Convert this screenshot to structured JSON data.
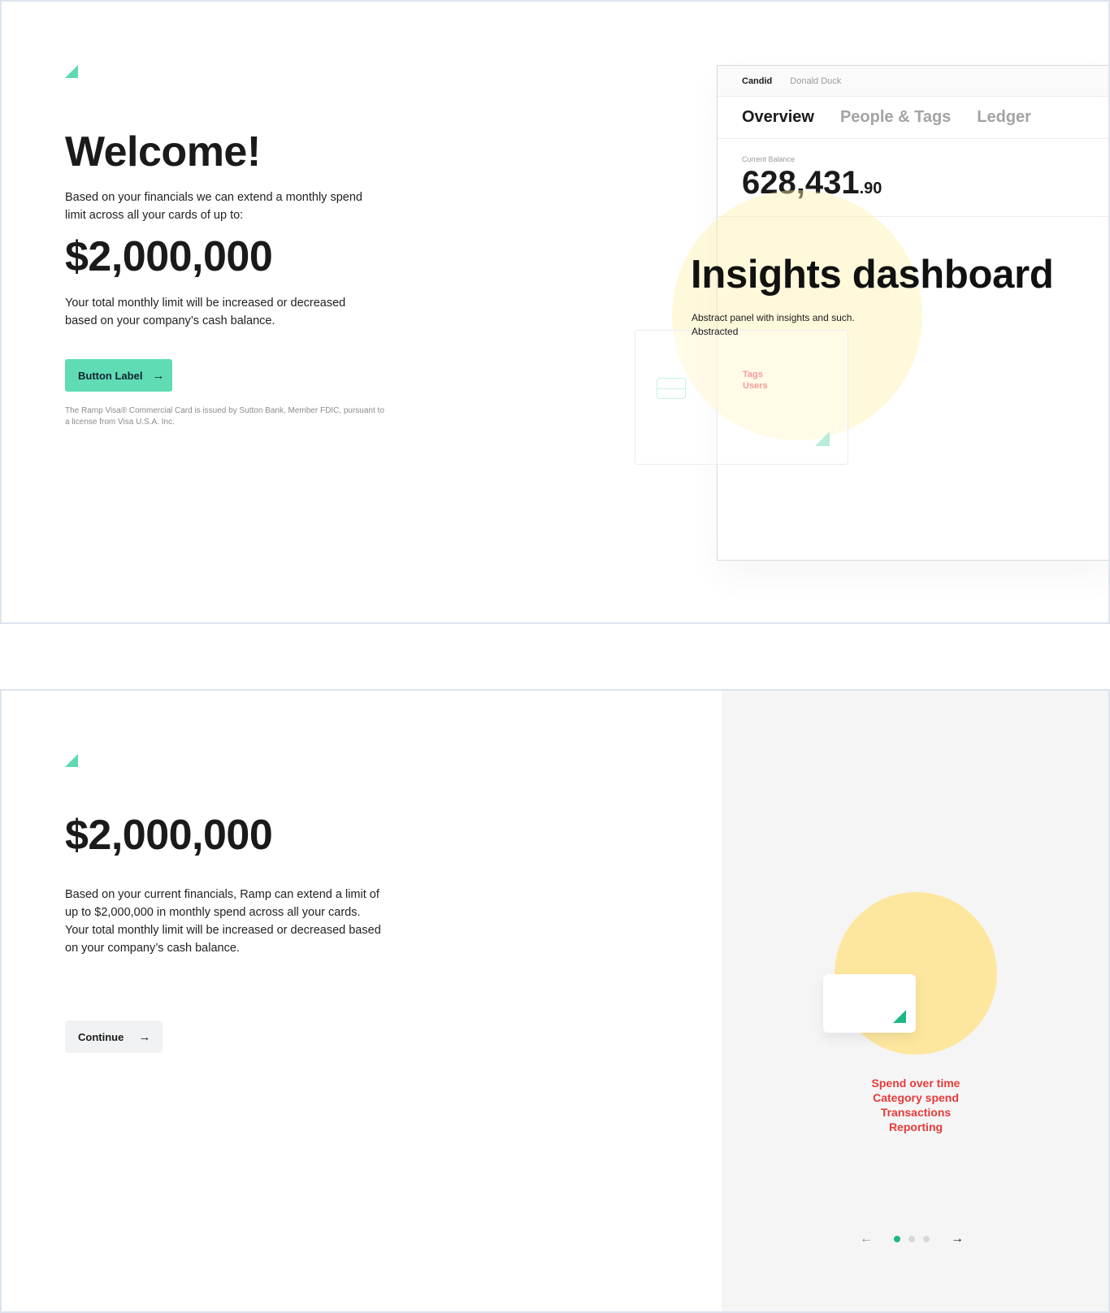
{
  "frame1": {
    "heading": "Welcome!",
    "intro": "Based on your financials we can extend a monthly spend limit across all your cards of up to:",
    "amount": "$2,000,000",
    "note": "Your total monthly limit will be increased or decreased based on your company’s cash balance.",
    "button_label": "Button Label",
    "fineprint": "The Ramp Visa® Commercial Card is issued by Sutton Bank, Member FDIC, pursuant to a license from Visa U.S.A. Inc.",
    "dashboard": {
      "org": "Candid",
      "user": "Donald Duck",
      "tabs": [
        "Overview",
        "People & Tags",
        "Ledger"
      ],
      "balance_label": "Current Balance",
      "balance_whole": "628,431",
      "balance_cents": ".90"
    },
    "mini_card_links": [
      "Tags",
      "Users"
    ],
    "insights_title": "Insights dashboard",
    "insights_desc": "Abstract panel with insights and such. Abstracted"
  },
  "frame2": {
    "amount": "$2,000,000",
    "description": "Based on your current financials, Ramp can extend a limit of up to $2,000,000 in monthly spend across all your cards. Your total monthly limit will be increased or decreased based on your company’s cash balance.",
    "continue_label": "Continue",
    "features": [
      "Spend over time",
      "Category spend",
      "Transactions",
      "Reporting"
    ],
    "carousel": {
      "total": 3,
      "active": 1
    }
  },
  "colors": {
    "brand_green": "#5fdcb3",
    "accent_green": "#1db784",
    "feature_red": "#e73a3a",
    "yellow": "#fde79f"
  },
  "icons": {
    "arrow_right": "→",
    "arrow_left": "←"
  }
}
